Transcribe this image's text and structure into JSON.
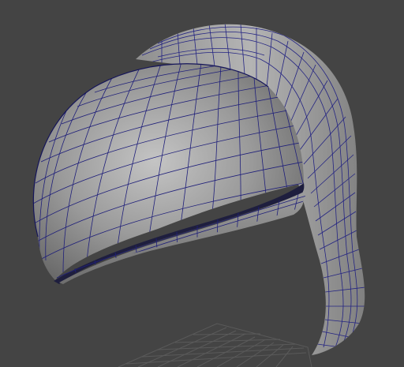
{
  "viewport": {
    "background": "#444444",
    "shading": "smooth-shade-wireframe",
    "wire_color": "#1c1c6e",
    "grid_visible": true
  },
  "model": {
    "name": "hair-bang-mesh",
    "surface_light": "#bdbdbd",
    "surface_mid": "#8a8a8a",
    "surface_dark": "#4a4a4a",
    "edge_wire": "#1f1f7a"
  }
}
